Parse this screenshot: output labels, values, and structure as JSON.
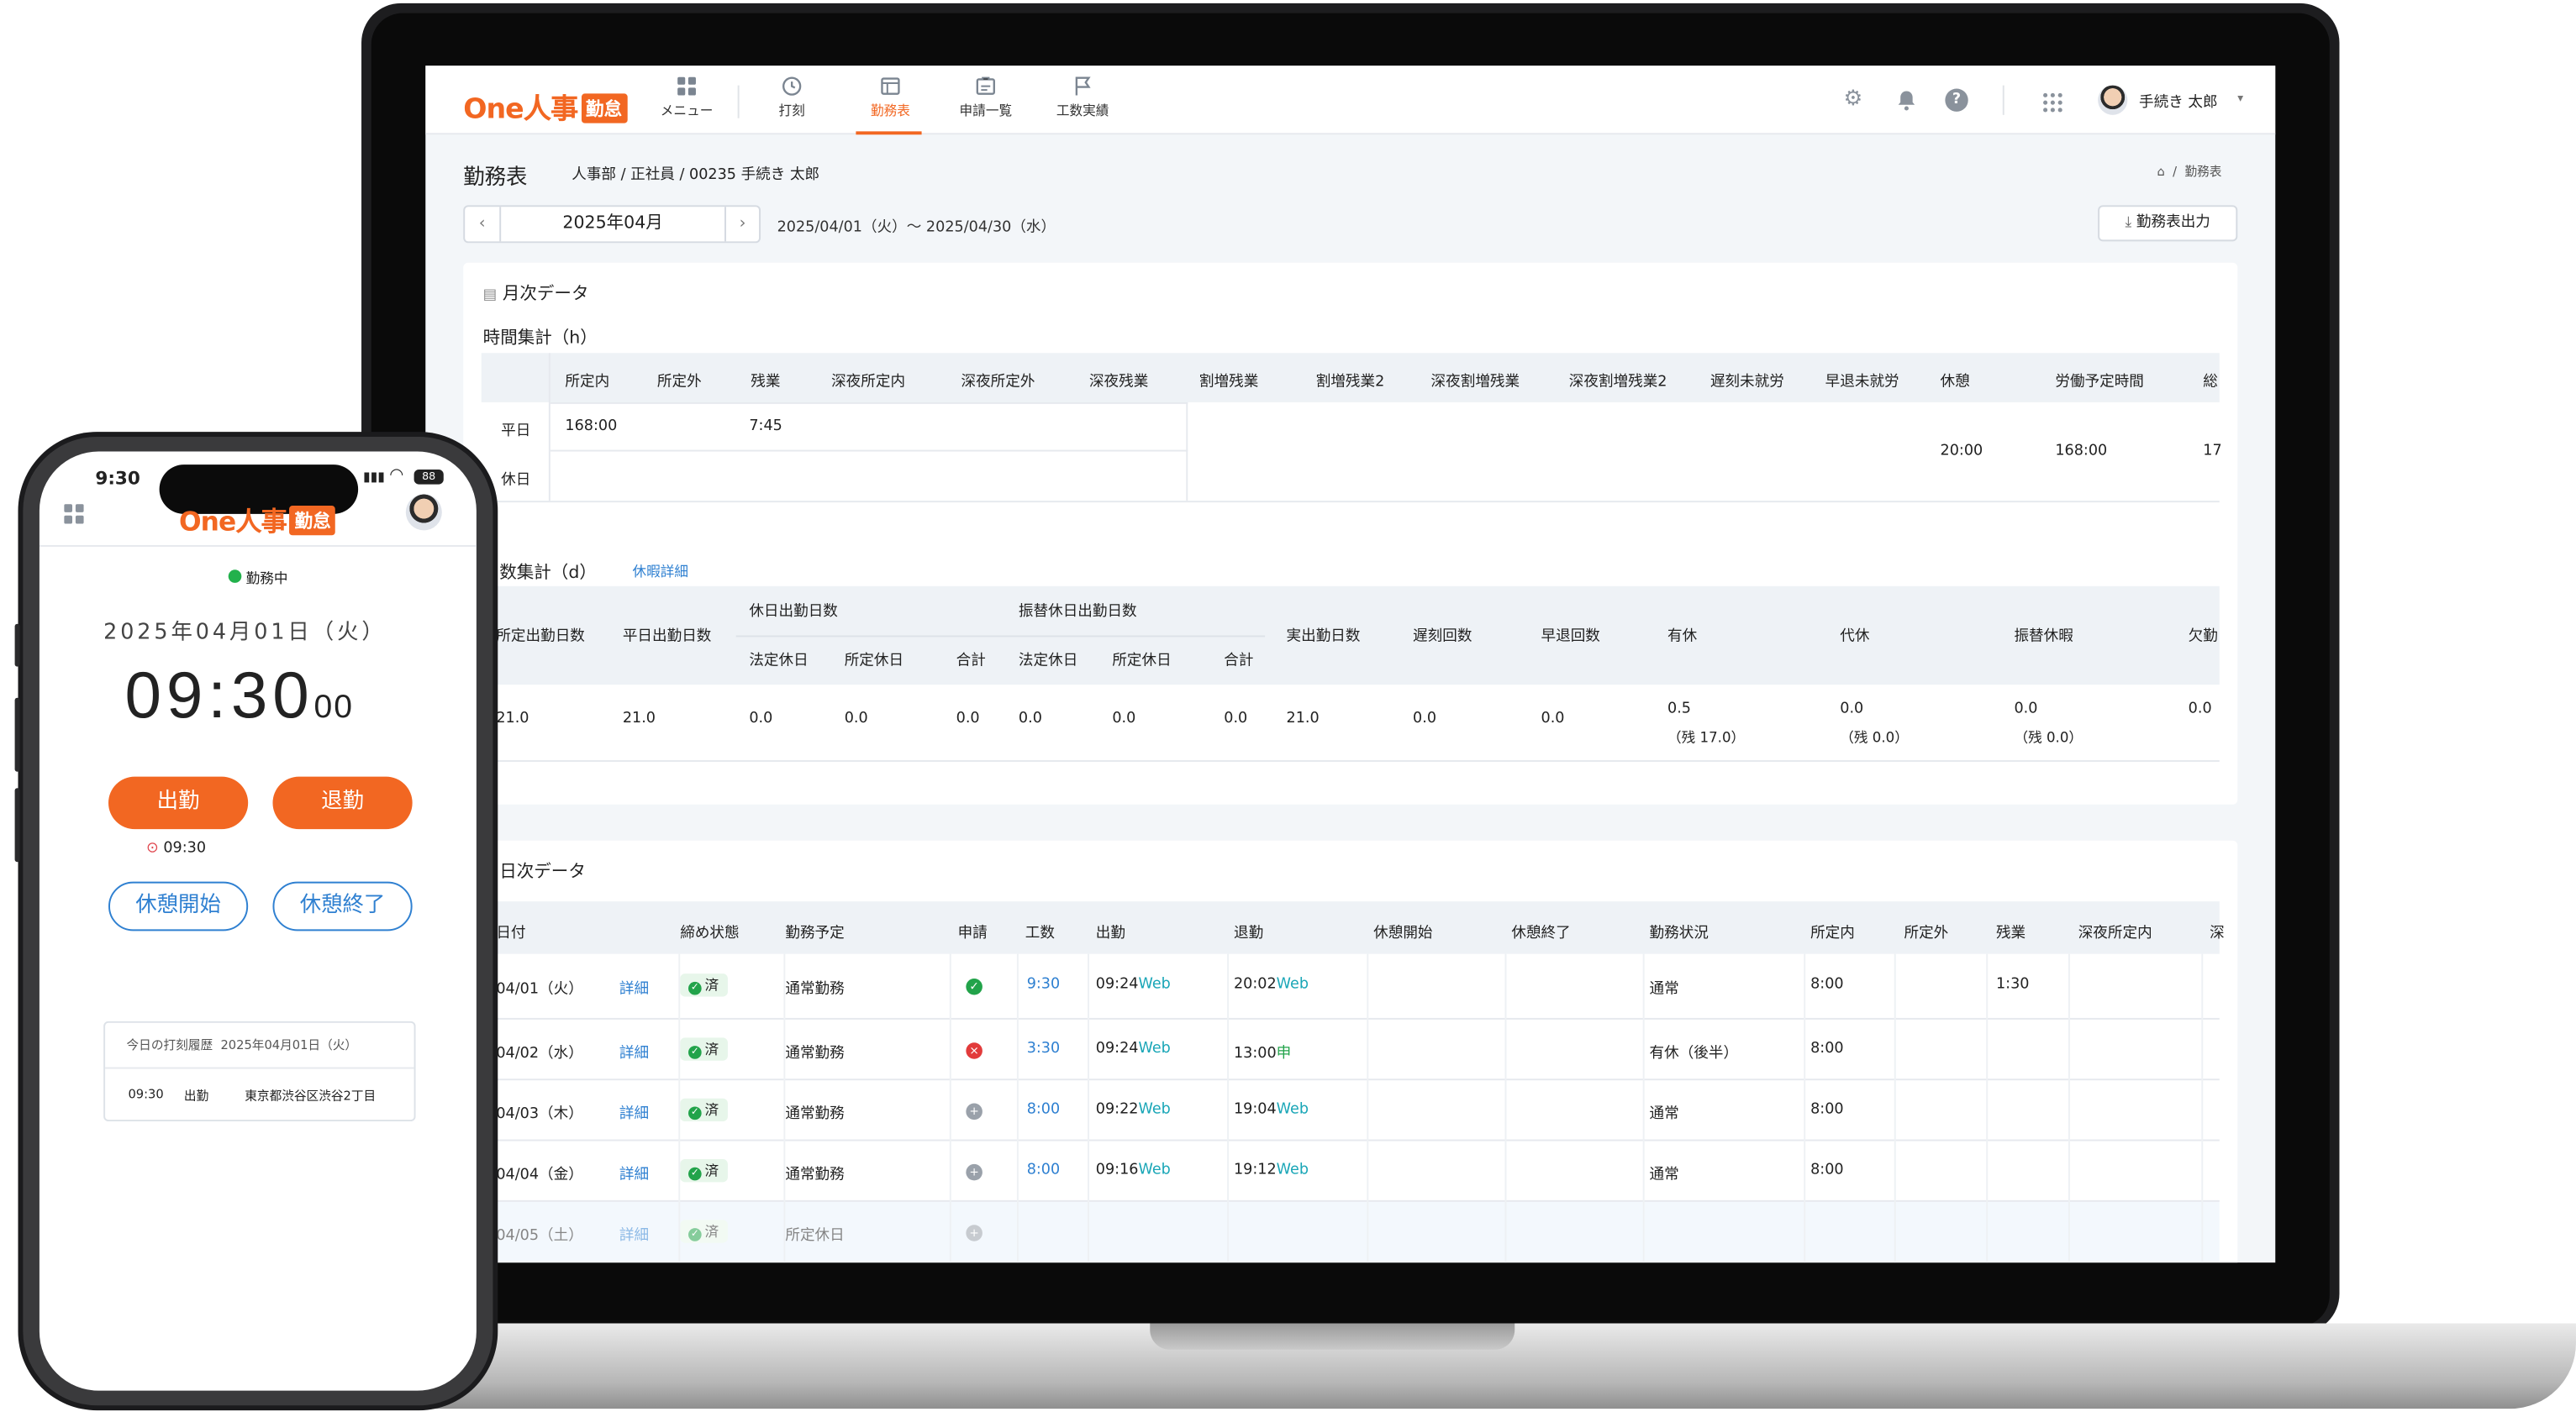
{
  "app": {
    "logo_text": "One人事",
    "logo_badge": "勤怠",
    "brand_color": "#f26722"
  },
  "nav": [
    {
      "label": "メニュー",
      "icon": "grid-icon"
    },
    {
      "label": "打刻",
      "icon": "clock-icon"
    },
    {
      "label": "勤務表",
      "icon": "timesheet-icon",
      "active": true
    },
    {
      "label": "申請一覧",
      "icon": "application-list-icon"
    },
    {
      "label": "工数実績",
      "icon": "flag-icon"
    }
  ],
  "user": {
    "name": "手続き 太郎"
  },
  "page": {
    "title": "勤務表",
    "context": "人事部 / 正社員 / 00235 手続き 太郎",
    "breadcrumb_current": "勤務表",
    "month": "2025年04月",
    "range": "2025/04/01（火）〜 2025/04/30（水）",
    "export_label": "勤務表出力"
  },
  "monthly": {
    "title": "月次データ",
    "time_title": "時間集計（h）",
    "time_headers": [
      "所定内",
      "所定外",
      "残業",
      "深夜所定内",
      "深夜所定外",
      "深夜残業",
      "割増残業",
      "割増残業2",
      "深夜割増残業",
      "深夜割増残業2",
      "遅刻未就労",
      "早退未就労",
      "休憩",
      "労働予定時間",
      "総"
    ],
    "weekday_label": "平日",
    "holiday_label": "休日",
    "weekday_vals": [
      "168:00",
      "",
      "7:45"
    ],
    "break_val": "20:00",
    "planned_val": "168:00",
    "total_partial": "17",
    "days_title": "数集計（d）",
    "leave_link": "休暇詳細",
    "days_h1": [
      "所定出勤日数",
      "平日出勤日数",
      "休日出勤日数",
      "振替休日出勤日数",
      "実出勤日数",
      "遅刻回数",
      "早退回数",
      "有休",
      "代休",
      "振替休暇",
      "欠勤"
    ],
    "days_sub": [
      "法定休日",
      "所定休日",
      "合計",
      "法定休日",
      "所定休日",
      "合計"
    ],
    "days_vals": [
      "21.0",
      "21.0",
      "0.0",
      "0.0",
      "0.0",
      "0.0",
      "0.0",
      "0.0",
      "21.0",
      "0.0",
      "0.0"
    ],
    "paid_leave": "0.5",
    "paid_rem": "（残 17.0）",
    "comp_leave": "0.0",
    "comp_rem": "（残 0.0）",
    "sub_leave": "0.0",
    "sub_rem": "（残 0.0）",
    "absence": "0.0"
  },
  "daily": {
    "title": "日次データ",
    "headers": [
      "日付",
      "締め状態",
      "勤務予定",
      "申請",
      "工数",
      "出勤",
      "退勤",
      "休憩開始",
      "休憩終了",
      "勤務状況",
      "所定内",
      "所定外",
      "残業",
      "深夜所定内",
      "深"
    ],
    "detail_label": "詳細",
    "closed_label": "済",
    "rows": [
      {
        "date": "04/01（火）",
        "plan": "通常勤務",
        "req": "ok",
        "hours": "9:30",
        "in": "09:24",
        "in_src": "Web",
        "out": "20:02",
        "out_src": "Web",
        "status": "通常",
        "base": "8:00",
        "ot": "1:30"
      },
      {
        "date": "04/02（水）",
        "plan": "通常勤務",
        "req": "ng",
        "hours": "3:30",
        "in": "09:24",
        "in_src": "Web",
        "out": "13:00",
        "out_src": "申",
        "status": "有休（後半）",
        "base": "8:00",
        "ot": ""
      },
      {
        "date": "04/03（木）",
        "plan": "通常勤務",
        "req": "add",
        "hours": "8:00",
        "in": "09:22",
        "in_src": "Web",
        "out": "19:04",
        "out_src": "Web",
        "status": "通常",
        "base": "8:00",
        "ot": ""
      },
      {
        "date": "04/04（金）",
        "plan": "通常勤務",
        "req": "add",
        "hours": "8:00",
        "in": "09:16",
        "in_src": "Web",
        "out": "19:12",
        "out_src": "Web",
        "status": "通常",
        "base": "8:00",
        "ot": ""
      },
      {
        "date": "04/05（土）",
        "plan": "所定休日",
        "req": "add",
        "hours": "",
        "in": "",
        "in_src": "",
        "out": "",
        "out_src": "",
        "status": "",
        "base": "",
        "ot": ""
      }
    ]
  },
  "phone": {
    "time": "9:30",
    "battery": "88",
    "status": "勤務中",
    "date": "2025年04月01日（火）",
    "clock_main": "09:30",
    "clock_sec": "00",
    "clock_in": "出勤",
    "clock_out": "退勤",
    "location_time": "09:30",
    "break_start": "休憩開始",
    "break_end": "休憩終了",
    "history_title": "今日の打刻履歴",
    "history_date": "2025年04月01日（火）",
    "history": [
      {
        "time": "09:30",
        "type": "出勤",
        "place": "東京都渋谷区渋谷2丁目"
      }
    ]
  }
}
